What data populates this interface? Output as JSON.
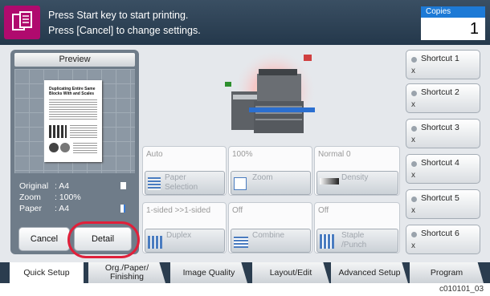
{
  "header": {
    "line1": "Press Start key to start printing.",
    "line2": "Press [Cancel] to change settings.",
    "copies_label": "Copies",
    "copies_value": "1",
    "app_icon": "copy-document-icon"
  },
  "preview": {
    "title": "Preview",
    "doc_heading": "Duplicating Entire Same Blocks With and Scales",
    "info": [
      {
        "key": "Original",
        "value": ": A4"
      },
      {
        "key": "Zoom",
        "value": ": 100%"
      },
      {
        "key": "Paper",
        "value": ": A4"
      }
    ],
    "cancel_label": "Cancel",
    "detail_label": "Detail"
  },
  "settings": [
    {
      "value": "Auto",
      "button": "Paper Selection",
      "icon": "paper-tray-icon"
    },
    {
      "value": "100%",
      "button": "Zoom",
      "icon": "zoom-icon"
    },
    {
      "value": "Normal 0",
      "button": "Density",
      "icon": "density-icon"
    },
    {
      "value": "1-sided >>1-sided",
      "button": "Duplex",
      "icon": "duplex-icon"
    },
    {
      "value": "Off",
      "button": "Combine",
      "icon": "combine-icon"
    },
    {
      "value": "Off",
      "button": "Staple /Punch",
      "icon": "staple-icon"
    }
  ],
  "shortcuts": [
    {
      "label": "Shortcut 1",
      "sub": "х"
    },
    {
      "label": "Shortcut 2",
      "sub": "х"
    },
    {
      "label": "Shortcut 3",
      "sub": "х"
    },
    {
      "label": "Shortcut 4",
      "sub": "х"
    },
    {
      "label": "Shortcut 5",
      "sub": "х"
    },
    {
      "label": "Shortcut 6",
      "sub": "х"
    }
  ],
  "tabs": [
    {
      "label": "Quick Setup",
      "active": true
    },
    {
      "label": "Org./Paper/ Finishing"
    },
    {
      "label": "Image Quality"
    },
    {
      "label": "Layout/Edit"
    },
    {
      "label": "Advanced Setup"
    },
    {
      "label": "Program"
    }
  ],
  "footer_code": "c010101_03"
}
